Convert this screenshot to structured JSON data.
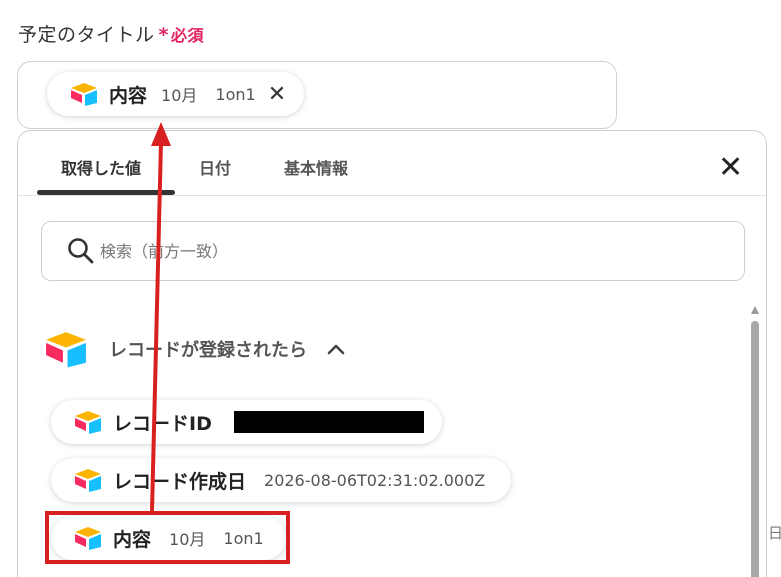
{
  "field": {
    "label": "予定のタイトル",
    "required_mark": "*",
    "required_text": "必須"
  },
  "selected_chip": {
    "name": "内容",
    "value1": "10月",
    "value2": "1on1",
    "close": "✕"
  },
  "tabs": [
    {
      "label": "取得した値",
      "active": true
    },
    {
      "label": "日付",
      "active": false
    },
    {
      "label": "基本情報",
      "active": false
    }
  ],
  "dropdown_close": "✕",
  "search": {
    "placeholder": "検索（前方一致）"
  },
  "section": {
    "title": "レコードが登録されたら"
  },
  "items": [
    {
      "name": "レコードID",
      "value": ""
    },
    {
      "name": "レコード作成日",
      "value": "2026-08-06T02:31:02.000Z"
    },
    {
      "name": "内容",
      "value1": "10月",
      "value2": "1on1"
    }
  ],
  "edge_text": "日時",
  "colors": {
    "required": "#e0245e",
    "highlight": "#d92020",
    "logo_yellow": "#fcb400",
    "logo_blue": "#18bfff",
    "logo_red": "#f82b60"
  }
}
